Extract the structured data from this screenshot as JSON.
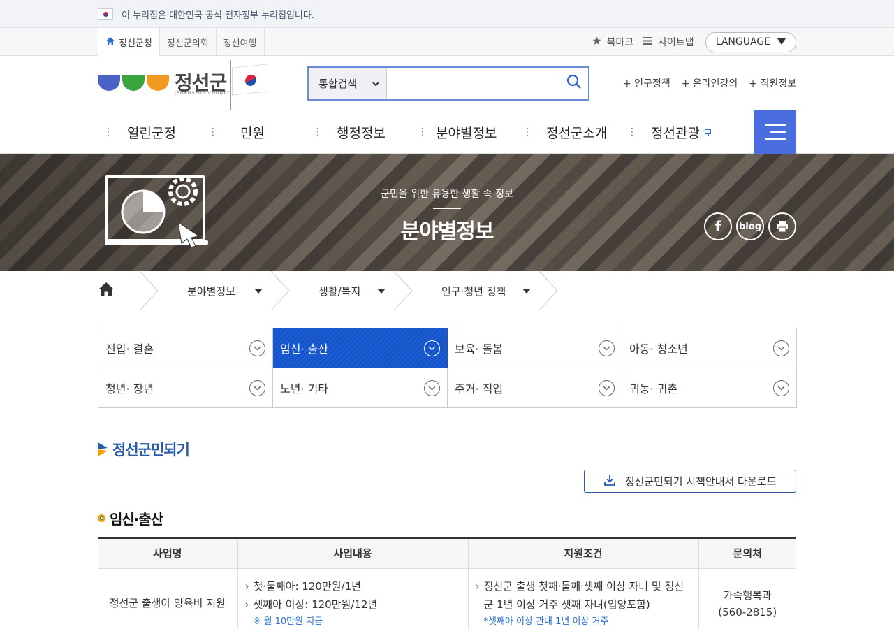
{
  "gov_banner": {
    "text": "이 누리집은 대한민국 공식 전자정부 누리집입니다."
  },
  "site_tabs": [
    {
      "label": "정선군청",
      "active": true
    },
    {
      "label": "정선군의회",
      "active": false
    },
    {
      "label": "정선여행",
      "active": false
    }
  ],
  "util": {
    "bookmark": "북마크",
    "sitemap": "사이트맵",
    "language": "LANGUAGE"
  },
  "logo": {
    "name": "정선군",
    "sub": "JEONGSEON COUNTY"
  },
  "search": {
    "scope": "통합검색",
    "placeholder": "",
    "value": ""
  },
  "quick_links": [
    "+ 인구정책",
    "+ 온라인강의",
    "+ 직원정보"
  ],
  "gnb": [
    {
      "label": "열린군정"
    },
    {
      "label": "민원"
    },
    {
      "label": "행정정보"
    },
    {
      "label": "분야별정보"
    },
    {
      "label": "정선군소개"
    },
    {
      "label": "정선관광"
    }
  ],
  "visual": {
    "subtitle": "군민을 위한 유용한 생활 속 정보",
    "title": "분야별정보",
    "social": [
      "f",
      "blog",
      "print"
    ]
  },
  "breadcrumb": [
    {
      "label": "분야별정보"
    },
    {
      "label": "생활/복지"
    },
    {
      "label": "인구·청년 정책"
    }
  ],
  "categories": [
    {
      "label": "전입· 결혼",
      "active": false
    },
    {
      "label": "임신· 출산",
      "active": true
    },
    {
      "label": "보육· 돌봄",
      "active": false
    },
    {
      "label": "아동· 청소년",
      "active": false
    },
    {
      "label": "청년· 장년",
      "active": false
    },
    {
      "label": "노년· 기타",
      "active": false
    },
    {
      "label": "주거· 직업",
      "active": false
    },
    {
      "label": "귀농· 귀촌",
      "active": false
    }
  ],
  "section": {
    "title": "정선군민되기",
    "download_label": "정선군민되기 시책안내서 다운로드",
    "subtitle": "임신·출산"
  },
  "table": {
    "headers": [
      "사업명",
      "사업내용",
      "지원조건",
      "문의처"
    ],
    "rows": [
      {
        "name": "정선군 출생아 양육비 지원",
        "content": [
          "첫·둘째아: 120만원/1년",
          "셋째아 이상: 120만원/12년"
        ],
        "content_note": "※ 월 10만원 지급",
        "condition": [
          "정선군 출생 첫째·둘째·셋째 이상 자녀 및 정선군 1년 이상 거주 셋째 자녀(입양포함)"
        ],
        "condition_note": "*셋째아 이상 관내 1년 이상 거주",
        "contact": [
          "가족행복과",
          "(560-2815)"
        ]
      }
    ]
  },
  "colors": {
    "accent": "#4a6ee0",
    "active_tab": "#1553c6",
    "title_blue": "#2a5aa8",
    "link_blue": "#2a6fcb"
  }
}
